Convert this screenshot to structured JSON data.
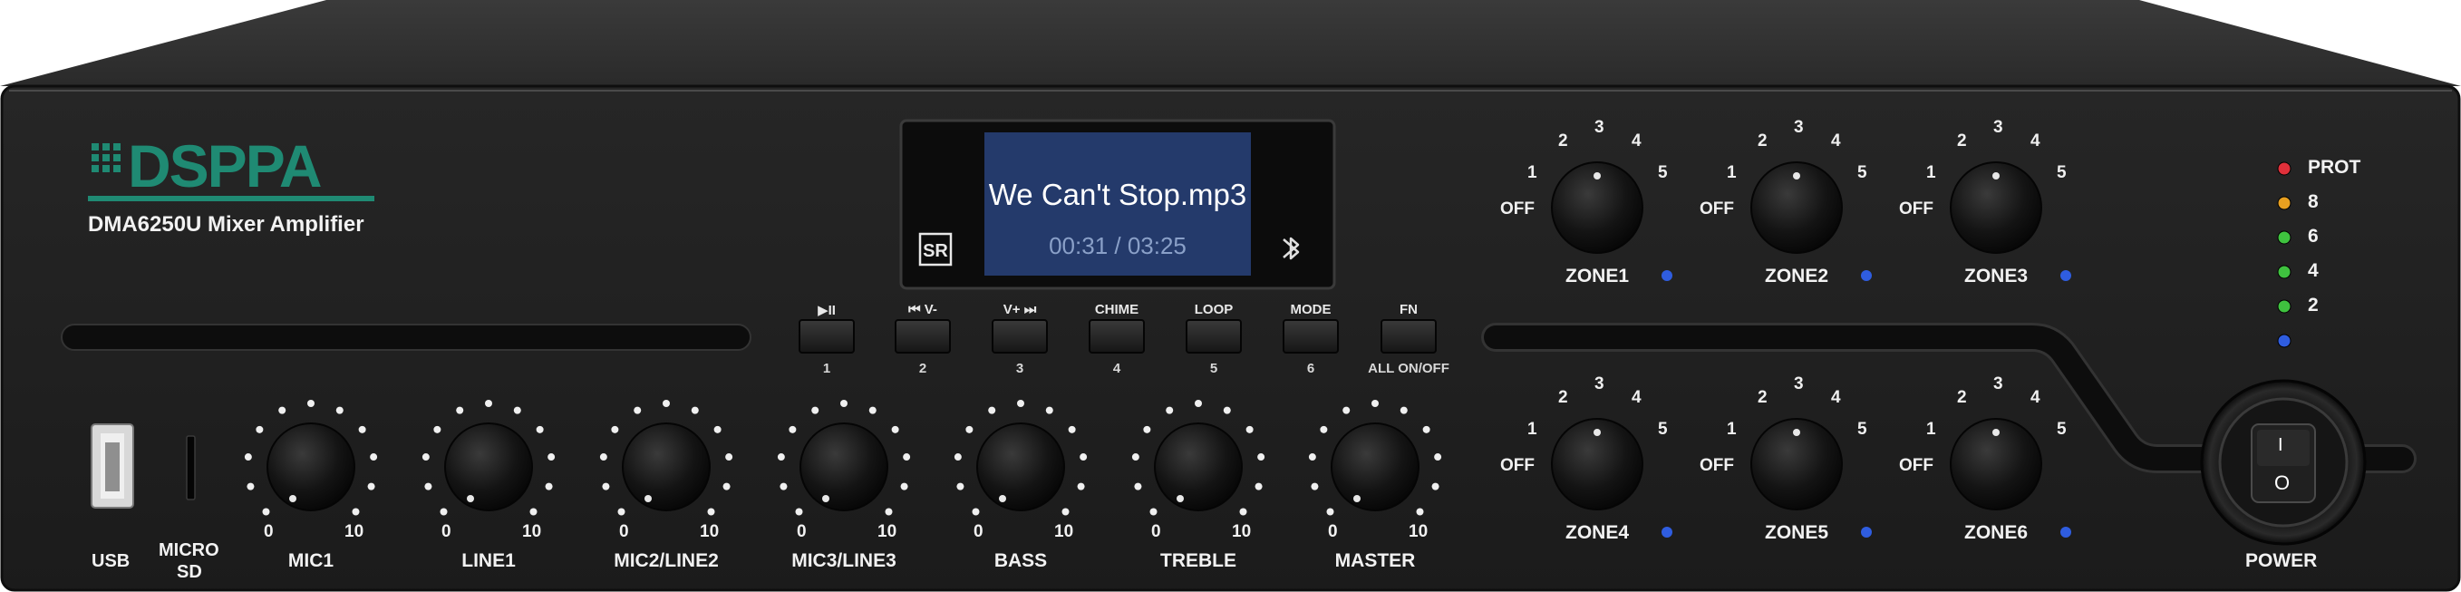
{
  "brand": {
    "logo_text": "DSPPA",
    "model": "DMA6250U Mixer Amplifier",
    "logo_color": "#1f8a73"
  },
  "display": {
    "title": "We Can't Stop.mp3",
    "time": "00:31 / 03:25",
    "badge_icon": "sr-badge-icon",
    "bluetooth_icon": "bluetooth-icon",
    "screen_color": "#243a6b"
  },
  "transport_buttons": [
    {
      "top": "▶II",
      "number": "1"
    },
    {
      "top": "⏮  V-",
      "number": "2"
    },
    {
      "top": "V+ ⏭",
      "number": "3"
    },
    {
      "top": "CHIME",
      "number": "4"
    },
    {
      "top": "LOOP",
      "number": "5"
    },
    {
      "top": "MODE",
      "number": "6"
    },
    {
      "top": "FN",
      "number": "ALL ON/OFF"
    }
  ],
  "inputs": {
    "usb_label": "USB",
    "micro_sd_label": [
      "MICRO",
      "SD"
    ]
  },
  "knobs": [
    {
      "label": "MIC1",
      "min": "0",
      "max": "10"
    },
    {
      "label": "LINE1",
      "min": "0",
      "max": "10"
    },
    {
      "label": "MIC2/LINE2",
      "min": "0",
      "max": "10"
    },
    {
      "label": "MIC3/LINE3",
      "min": "0",
      "max": "10"
    },
    {
      "label": "BASS",
      "min": "0",
      "max": "10"
    },
    {
      "label": "TREBLE",
      "min": "0",
      "max": "10"
    },
    {
      "label": "MASTER",
      "min": "0",
      "max": "10"
    }
  ],
  "zone_scale": [
    "OFF",
    "1",
    "2",
    "3",
    "4",
    "5"
  ],
  "zones": [
    {
      "label": "ZONE1"
    },
    {
      "label": "ZONE2"
    },
    {
      "label": "ZONE3"
    },
    {
      "label": "ZONE4"
    },
    {
      "label": "ZONE5"
    },
    {
      "label": "ZONE6"
    }
  ],
  "leds": [
    {
      "label": "PROT",
      "color": "#e0303a"
    },
    {
      "label": "8",
      "color": "#e8a020"
    },
    {
      "label": "6",
      "color": "#3fc23f"
    },
    {
      "label": "4",
      "color": "#3fc23f"
    },
    {
      "label": "2",
      "color": "#3fc23f"
    },
    {
      "label": "",
      "color": "#2f5de0"
    }
  ],
  "power": {
    "label": "POWER",
    "on_symbol": "I",
    "off_symbol": "O"
  },
  "colors": {
    "panel": "#1e1e1e",
    "zone_indicator": "#2f5de0"
  }
}
